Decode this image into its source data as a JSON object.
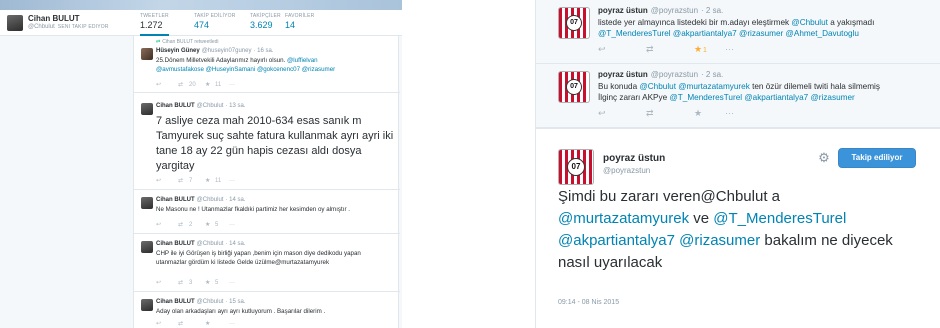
{
  "left": {
    "profile": {
      "name": "Cihan BULUT",
      "handle": "@Chbulut",
      "follows_you": "SENI TAKIP EDIYOR"
    },
    "stats": [
      {
        "label": "TWEETLER",
        "value": "1.272"
      },
      {
        "label": "TAKİP EDİLİYOR",
        "value": "474"
      },
      {
        "label": "TAKİPÇİLER",
        "value": "3.629"
      },
      {
        "label": "FAVORİLER",
        "value": "14"
      }
    ],
    "tweets": [
      {
        "context": "Cihan BULUT retweetledi",
        "name": "Hüseyin Güney",
        "handle": "@huseyin07guney",
        "time": "· 16 sa.",
        "line1": "25.Dönem Milletvekili Adaylarımız  hayırlı olsun. ",
        "line1_link": "@luffielvan",
        "line2_link": "@avmustafakose @HuseyinSamani @gokcenenc07 @rizasumer",
        "retweets": "20",
        "favorites": "11"
      },
      {
        "name": "Cihan BULUT",
        "handle": "@Chbulut",
        "time": "· 13 sa.",
        "text": "7 asliye ceza mah 2010-634 esas sanık m Tamyurek suç sahte fatura kullanmak ayrı ayri iki tane 18 ay 22 gün hapis cezası aldı dosya yargitay",
        "retweets": "7",
        "favorites": "11"
      },
      {
        "name": "Cihan BULUT",
        "handle": "@Chbulut",
        "time": "· 14 sa.",
        "text": "Ne Masonu ne ! Utanmazlar fkaldıki partimiz her kesimden oy almıştır .",
        "retweets": "2",
        "favorites": "5"
      },
      {
        "name": "Cihan BULUT",
        "handle": "@Chbulut",
        "time": "· 14 sa.",
        "text": "CHP ile  iyi Görüşen iş birliği yapan ,benim için mason diye dedikodu yapan utanmazlar gördüm ki listede Gelde üzülme@murtazatamyurek",
        "retweets": "3",
        "favorites": "5"
      },
      {
        "name": "Cihan BULUT",
        "handle": "@Chbulut",
        "time": "· 15 sa.",
        "text": "Aday olan arkadaşları ayrı ayrı kutluyorum . Başarılar dilerim ."
      }
    ]
  },
  "right": {
    "tweets": [
      {
        "logo_text": "07",
        "name": "poyraz üstun",
        "handle": "@poyrazstun",
        "time": "· 2 sa.",
        "line1": "listede yer almayınca listedeki bir m.adayı eleştirmek ",
        "line1_link": "@Chbulut",
        "line1_tail": " a yakışmadı",
        "line2_link": "@T_MenderesTurel @akpartiantalya7 @rizasumer @Ahmet_Davutoglu",
        "favorites": "1"
      },
      {
        "logo_text": "07",
        "name": "poyraz üstun",
        "handle": "@poyrazstun",
        "time": "· 2 sa.",
        "line1": "Bu konuda ",
        "line1_link": "@Chbulut @murtazatamyurek",
        "line1_tail": " ten özür dilemeli twiti hala silmemiş",
        "line2": "İlginç zararı AKPye ",
        "line2_link": "@T_MenderesTurel @akpartiantalya7 @rizasumer"
      }
    ],
    "permalink": {
      "logo_text": "07",
      "name": "poyraz üstun",
      "handle": "@poyrazstun",
      "follow_label": "Takip ediliyor",
      "body_1": "Şimdi bu zararı veren@Chbulut a",
      "mention_1": "@murtazatamyurek",
      "body_2": " ve  ",
      "mention_2": "@T_MenderesTurel",
      "mention_3": "@akpartiantalya7",
      "mention_4": "@rizasumer",
      "body_3": " bakalım ne diyecek nasıl uyarılacak",
      "timestamp": "09:14 - 08 Nis 2015"
    }
  },
  "icons": {
    "reply": "reply-icon",
    "retweet": "retweet-icon",
    "favorite": "star-icon",
    "more": "more-icon",
    "gear": "gear-icon"
  },
  "colors": {
    "link": "#0084b4",
    "follow_button": "#3b94d9",
    "favorite_active": "#ffac33",
    "retweet_context": "#19cf86"
  }
}
